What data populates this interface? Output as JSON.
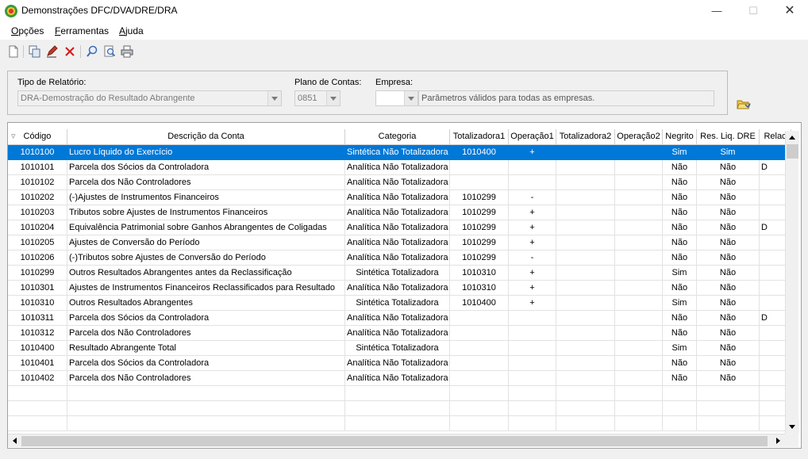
{
  "window": {
    "title": "Demonstrações DFC/DVA/DRE/DRA",
    "minimize": "—",
    "maximize": "☐",
    "close": "✕"
  },
  "menu": [
    {
      "label_rest": "pções",
      "accel": "O"
    },
    {
      "label_rest": "erramentas",
      "accel": "F"
    },
    {
      "label_rest": "juda",
      "accel": "A"
    }
  ],
  "toolbar": {
    "icons": [
      "new-document-icon",
      "copy-icon",
      "edit-icon",
      "delete-icon",
      "search-icon",
      "zoom-search-icon",
      "print-icon"
    ]
  },
  "params": {
    "report_type_label": "Tipo de Relatório:",
    "report_type_value": "DRA-Demostração do Resultado Abrangente",
    "chart_of_accounts_label": "Plano de Contas:",
    "chart_of_accounts_value": "0851",
    "company_label": "Empresa:",
    "company_value": "",
    "company_info": "Parâmetros válidos para todas as empresas."
  },
  "grid": {
    "columns": [
      "Código",
      "Descrição da Conta",
      "Categoria",
      "Totalizadora1",
      "Operação1",
      "Totalizadora2",
      "Operação2",
      "Negrito",
      "Res. Liq. DRE",
      "Relac"
    ],
    "rows": [
      [
        "1010100",
        "Lucro Líquido do Exercício",
        "Sintética Não Totalizadora",
        "1010400",
        "+",
        "",
        "",
        "Sim",
        "Sim",
        ""
      ],
      [
        "1010101",
        "Parcela dos Sócios da Controladora",
        "Analítica Não Totalizadora",
        "",
        "",
        "",
        "",
        "Não",
        "Não",
        "D"
      ],
      [
        "1010102",
        "Parcela dos Não Controladores",
        "Analítica Não Totalizadora",
        "",
        "",
        "",
        "",
        "Não",
        "Não",
        ""
      ],
      [
        "1010202",
        "(-)Ajustes de Instrumentos Financeiros",
        "Analítica Não Totalizadora",
        "1010299",
        "-",
        "",
        "",
        "Não",
        "Não",
        ""
      ],
      [
        "1010203",
        "Tributos sobre Ajustes de Instrumentos Financeiros",
        "Analítica Não Totalizadora",
        "1010299",
        "+",
        "",
        "",
        "Não",
        "Não",
        ""
      ],
      [
        "1010204",
        "Equivalência Patrimonial sobre Ganhos Abrangentes de Coligadas",
        "Analítica Não Totalizadora",
        "1010299",
        "+",
        "",
        "",
        "Não",
        "Não",
        "D"
      ],
      [
        "1010205",
        "Ajustes de Conversão do Período",
        "Analítica Não Totalizadora",
        "1010299",
        "+",
        "",
        "",
        "Não",
        "Não",
        ""
      ],
      [
        "1010206",
        "(-)Tributos sobre Ajustes de Conversão do Período",
        "Analítica Não Totalizadora",
        "1010299",
        "-",
        "",
        "",
        "Não",
        "Não",
        ""
      ],
      [
        "1010299",
        "Outros Resultados Abrangentes antes da Reclassificação",
        "Sintética Totalizadora",
        "1010310",
        "+",
        "",
        "",
        "Sim",
        "Não",
        ""
      ],
      [
        "1010301",
        "Ajustes de Instrumentos Financeiros Reclassificados para Resultado",
        "Analítica Não Totalizadora",
        "1010310",
        "+",
        "",
        "",
        "Não",
        "Não",
        ""
      ],
      [
        "1010310",
        "Outros Resultados Abrangentes",
        "Sintética Totalizadora",
        "1010400",
        "+",
        "",
        "",
        "Sim",
        "Não",
        ""
      ],
      [
        "1010311",
        "Parcela dos Sócios da Controladora",
        "Analítica Não Totalizadora",
        "",
        "",
        "",
        "",
        "Não",
        "Não",
        "D"
      ],
      [
        "1010312",
        "Parcela dos Não Controladores",
        "Analítica Não Totalizadora",
        "",
        "",
        "",
        "",
        "Não",
        "Não",
        ""
      ],
      [
        "1010400",
        "Resultado Abrangente Total",
        "Sintética Totalizadora",
        "",
        "",
        "",
        "",
        "Sim",
        "Não",
        ""
      ],
      [
        "1010401",
        "Parcela dos Sócios da Controladora",
        "Analítica Não Totalizadora",
        "",
        "",
        "",
        "",
        "Não",
        "Não",
        ""
      ],
      [
        "1010402",
        "Parcela dos Não Controladores",
        "Analítica Não Totalizadora",
        "",
        "",
        "",
        "",
        "Não",
        "Não",
        ""
      ],
      [
        "",
        "",
        "",
        "",
        "",
        "",
        "",
        "",
        "",
        ""
      ],
      [
        "",
        "",
        "",
        "",
        "",
        "",
        "",
        "",
        "",
        ""
      ],
      [
        "",
        "",
        "",
        "",
        "",
        "",
        "",
        "",
        "",
        ""
      ]
    ],
    "selected_row": 0
  }
}
